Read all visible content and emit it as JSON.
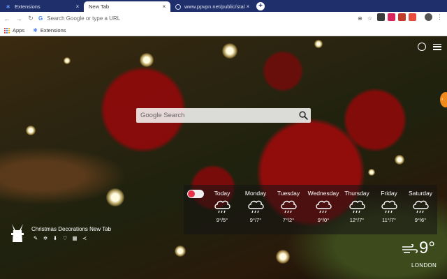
{
  "browser": {
    "tabs": [
      {
        "title": "Extensions",
        "active": false,
        "icon": "puzzle-icon"
      },
      {
        "title": "New Tab",
        "active": true,
        "icon": ""
      },
      {
        "title": "www.ppvpn.net/public/stall/C",
        "active": false,
        "icon": "globe-icon"
      }
    ],
    "address_placeholder": "Search Google or type a URL",
    "bookmarks": [
      {
        "label": "Apps",
        "icon": "apps-grid-icon"
      },
      {
        "label": "Extensions",
        "icon": "puzzle-icon"
      }
    ],
    "tab_bar_color": "#1f2f6b"
  },
  "newtab": {
    "search_placeholder": "Google Search",
    "weather": {
      "toggle_color": "#e8324a",
      "days": [
        {
          "name": "Today",
          "temps": "9°/5°",
          "icon": "rain-cloud-icon"
        },
        {
          "name": "Monday",
          "temps": "9°/7°",
          "icon": "rain-cloud-icon"
        },
        {
          "name": "Tuesday",
          "temps": "7°/2°",
          "icon": "rain-cloud-icon"
        },
        {
          "name": "Wednesday",
          "temps": "9°/0°",
          "icon": "rain-cloud-icon"
        },
        {
          "name": "Thursday",
          "temps": "12°/7°",
          "icon": "rain-cloud-icon"
        },
        {
          "name": "Friday",
          "temps": "11°/7°",
          "icon": "rain-cloud-icon"
        },
        {
          "name": "Saturday",
          "temps": "9°/6°",
          "icon": "rain-cloud-icon"
        }
      ],
      "current": {
        "temp": "9°",
        "city": "LONDON",
        "icon": "wind-icon"
      }
    },
    "brand": {
      "title": "Christmas Decorations New Tab",
      "icons": [
        "wrench-icon",
        "gear-icon",
        "download-icon",
        "heart-icon",
        "grid-icon",
        "share-icon"
      ]
    }
  }
}
